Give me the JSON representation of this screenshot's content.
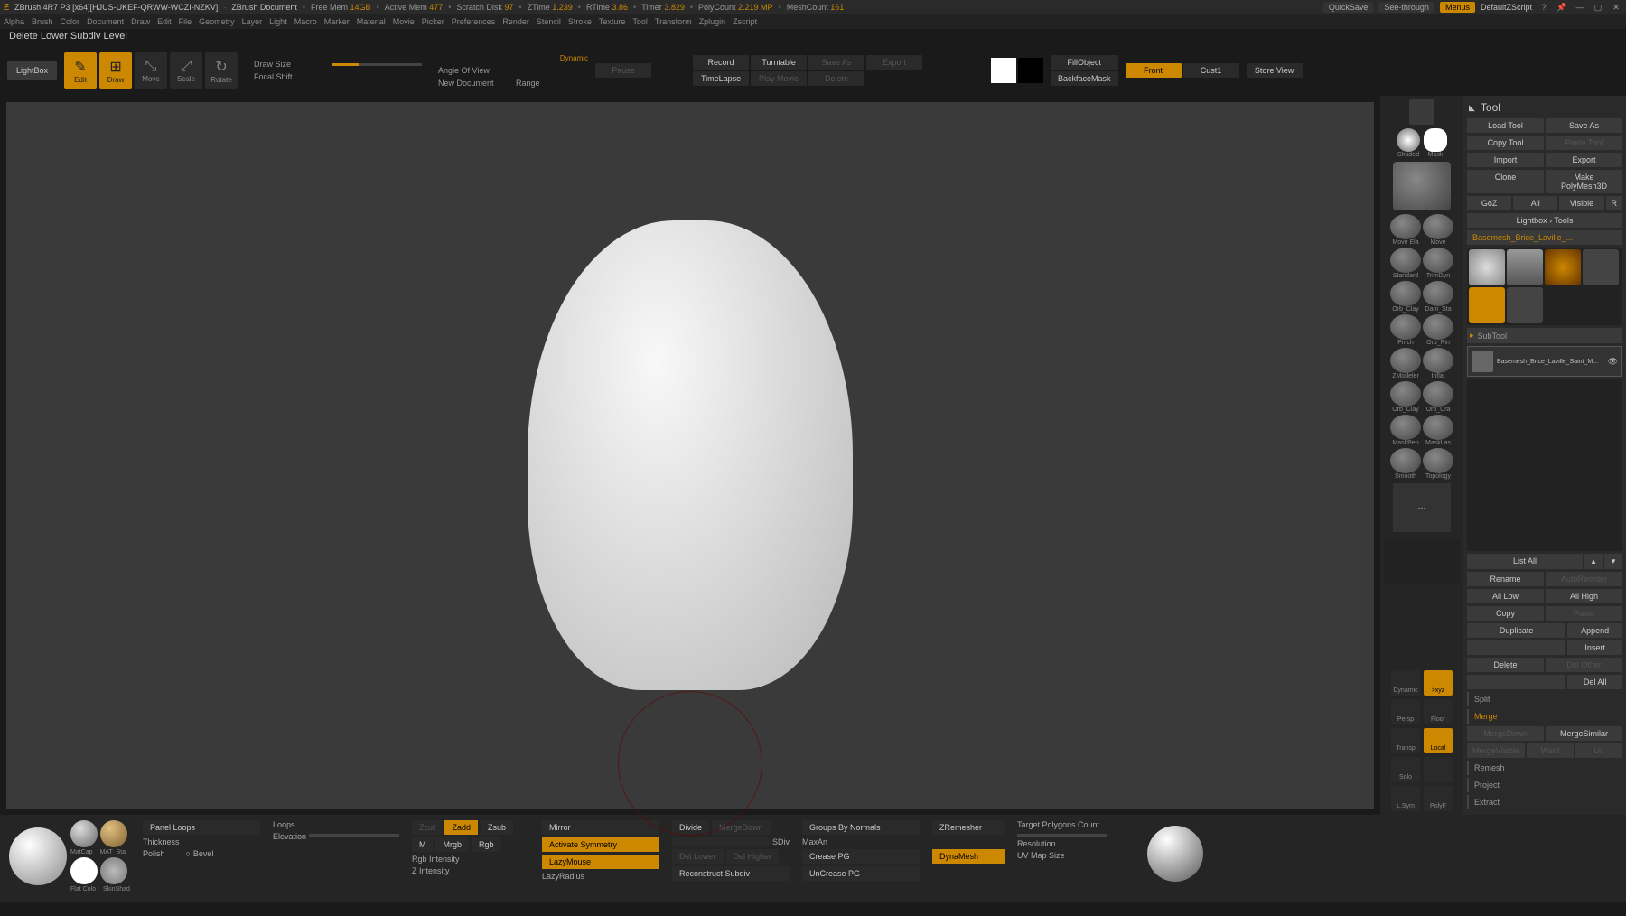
{
  "titlebar": {
    "app": "ZBrush 4R7 P3  [x64][HJUS-UKEF-QRWW-WCZI-NZKV]",
    "doc": "ZBrush Document",
    "stats": [
      {
        "k": "Free Mem",
        "v": "14GB"
      },
      {
        "k": "Active Mem",
        "v": "477"
      },
      {
        "k": "Scratch Disk",
        "v": "97"
      },
      {
        "k": "ZTime",
        "v": "1.239"
      },
      {
        "k": "RTime",
        "v": "3.86"
      },
      {
        "k": "Timer",
        "v": "3.829"
      },
      {
        "k": "PolyCount",
        "v": "2.219 MP"
      },
      {
        "k": "MeshCount",
        "v": "161"
      }
    ],
    "quicksave": "QuickSave",
    "seethrough": "See-through",
    "menus": "Menus",
    "script": "DefaultZScript"
  },
  "menu": [
    "Alpha",
    "Brush",
    "Color",
    "Document",
    "Draw",
    "Edit",
    "File",
    "Geometry",
    "Layer",
    "Light",
    "Macro",
    "Marker",
    "Material",
    "Movie",
    "Picker",
    "Preferences",
    "Render",
    "Stencil",
    "Stroke",
    "Texture",
    "Tool",
    "Transform",
    "Zplugin",
    "Zscript"
  ],
  "tooltip": "Delete Lower Subdiv Level",
  "ribbon": {
    "lightbox": "LightBox",
    "modes": [
      {
        "l": "Edit",
        "g": "✎"
      },
      {
        "l": "Draw",
        "g": "⊞"
      },
      {
        "l": "Move",
        "g": "⤡"
      },
      {
        "l": "Scale",
        "g": "⤢"
      },
      {
        "l": "Rotate",
        "g": "↻"
      }
    ],
    "drawsize": "Draw Size",
    "focalshift": "Focal Shift",
    "dynamic": "Dynamic",
    "angle": "Angle Of View",
    "newdoc": "New Document",
    "range": "Range",
    "pause": "Pause",
    "record": "Record",
    "turntable": "Turntable",
    "saveas": "Save As",
    "export": "Export",
    "timelapse": "TimeLapse",
    "playmovie": "Play Movie",
    "delete": "Delete",
    "fillobj": "FillObject",
    "backface": "BackfaceMask",
    "front": "Front",
    "cust1": "Cust1",
    "storeview": "Store View"
  },
  "rside": {
    "shaded": "Shaded",
    "mask": "Mask",
    "brushes": [
      "Move Ela",
      "Move",
      "Standard",
      "TrimDyn",
      "Orb_Clay",
      "Dam_Sta",
      "Pinch",
      "Orb_Pin",
      "ZModeler",
      "Inflat",
      "Orb_Clay",
      "Orb_Cra",
      "MaskPen",
      "MaskLas",
      "Smooth",
      "Topology"
    ],
    "nav": {
      "dynamic": "Dynamic",
      "persp": "Persp",
      "xyz": ">xyz",
      "transp": "Transp",
      "solo": "Solo",
      "local": "Local",
      "floor": "Floor",
      "lsym": "L.Sym",
      "polyf": "PolyF"
    }
  },
  "tool": {
    "title": "Tool",
    "load": "Load Tool",
    "saveas": "Save As",
    "copy": "Copy Tool",
    "paste": "Paste Tool",
    "import": "Import",
    "export": "Export",
    "clone": "Clone",
    "makepoly": "Make PolyMesh3D",
    "goz": "GoZ",
    "all": "All",
    "visible": "Visible",
    "r": "R",
    "lightbox": "Lightbox › Tools",
    "current": "Basemesh_Brice_Laville_...",
    "subtool": "SubTool",
    "subtool_name": "Basemesh_Brice_Laville_Saint_M...",
    "listall": "List All",
    "rename": "Rename",
    "autoreorder": "AutoReorder",
    "alllow": "All Low",
    "allhigh": "All High",
    "copy2": "Copy",
    "paste2": "Paste",
    "duplicate": "Duplicate",
    "append": "Append",
    "insert": "Insert",
    "delete": "Delete",
    "delother": "Del Other",
    "delall": "Del All",
    "split": "Split",
    "merge": "Merge",
    "mergedown": "MergeDown",
    "mergesimilar": "MergeSimilar",
    "mergevisible": "MergeVisible",
    "weld": "Weld",
    "uv": "Uv",
    "remesh": "Remesh",
    "project": "Project",
    "extract": "Extract"
  },
  "shelf": {
    "matcap": "MatCap",
    "mat_sta": "MAT_Sta",
    "flatcol": "Flat Colo",
    "skinshad": "SkinShad",
    "panelloops": "Panel Loops",
    "thickness": "Thickness",
    "polish": "Polish",
    "bevel": "Bevel",
    "loops": "Loops",
    "elevation": "Elevation",
    "rgbint": "Rgb Intensity",
    "zint": "Z Intensity",
    "zcut": "Zcut",
    "zadd": "Zadd",
    "zsub": "Zsub",
    "m": "M",
    "mrgb": "Mrgb",
    "rgb": "Rgb",
    "mirror": "Mirror",
    "symmetry": "Activate Symmetry",
    "lazymouse": "LazyMouse",
    "lazyradius": "LazyRadius",
    "divide": "Divide",
    "mergedown": "MergeDown",
    "sdiv": "SDiv",
    "dellower": "Del Lower",
    "delhigher": "Del Higher",
    "recon": "Reconstruct Subdiv",
    "groups": "Groups By Normals",
    "maxan": "MaxAn",
    "crease": "Crease PG",
    "uncrease": "UnCrease PG",
    "zremesher": "ZRemesher",
    "dynamesh": "DynaMesh",
    "polycount": "Target Polygons Count",
    "resolution": "Resolution",
    "uvmap": "UV Map Size"
  }
}
